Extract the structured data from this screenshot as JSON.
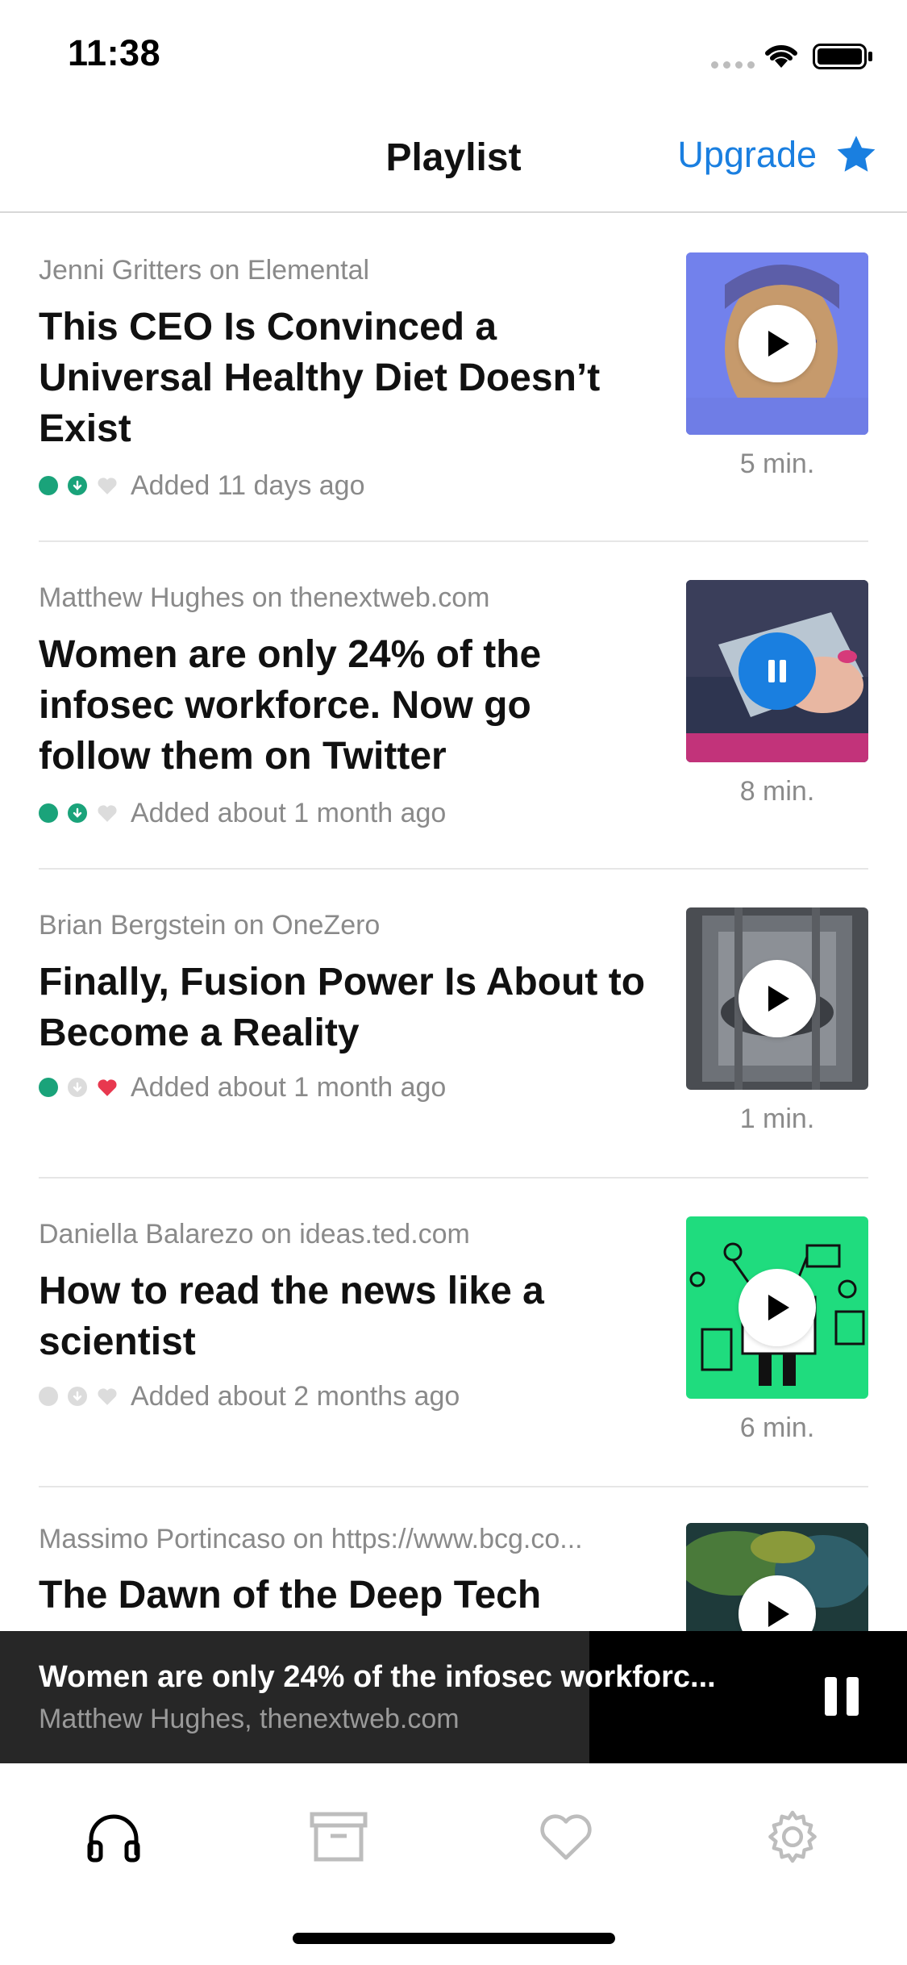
{
  "status": {
    "time": "11:38"
  },
  "nav": {
    "title": "Playlist",
    "upgrade_label": "Upgrade"
  },
  "items": [
    {
      "byline": "Jenni Gritters on Elemental",
      "title": "This CEO Is Convinced a Universal Healthy Diet Doesn’t Exist",
      "added": "Added 11 days ago",
      "duration": "5 min.",
      "status_dot": "green",
      "downloaded": true,
      "liked": false,
      "control": "play"
    },
    {
      "byline": "Matthew Hughes on thenextweb.com",
      "title": "Women are only 24% of the infosec workforce. Now go follow them on Twitter",
      "added": "Added about 1 month ago",
      "duration": "8 min.",
      "status_dot": "green",
      "downloaded": true,
      "liked": false,
      "control": "pause"
    },
    {
      "byline": "Brian Bergstein on OneZero",
      "title": "Finally, Fusion Power Is About to Become a Reality",
      "added": "Added about 1 month ago",
      "duration": "1 min.",
      "status_dot": "green",
      "downloaded": false,
      "liked": true,
      "control": "play"
    },
    {
      "byline": "Daniella Balarezo on ideas.ted.com",
      "title": "How to read the news like a scientist",
      "added": "Added about 2 months ago",
      "duration": "6 min.",
      "status_dot": "grey",
      "downloaded": false,
      "liked": false,
      "control": "play"
    },
    {
      "byline": "Massimo Portincaso on https://www.bcg.co...",
      "title": "The Dawn of the Deep Tech",
      "control": "play"
    }
  ],
  "now_playing": {
    "title": "Women are only 24% of the infosec workforc...",
    "subtitle": "Matthew Hughes, thenextweb.com",
    "progress_fraction": 0.65
  },
  "tabs": [
    {
      "icon": "headphones-icon",
      "active": true
    },
    {
      "icon": "archive-icon",
      "active": false
    },
    {
      "icon": "heart-icon",
      "active": false
    },
    {
      "icon": "gear-icon",
      "active": false
    }
  ],
  "colors": {
    "accent": "#1a7fe0",
    "green": "#1aa37a",
    "heart_red": "#e8384f",
    "muted": "#8a8a8a"
  }
}
